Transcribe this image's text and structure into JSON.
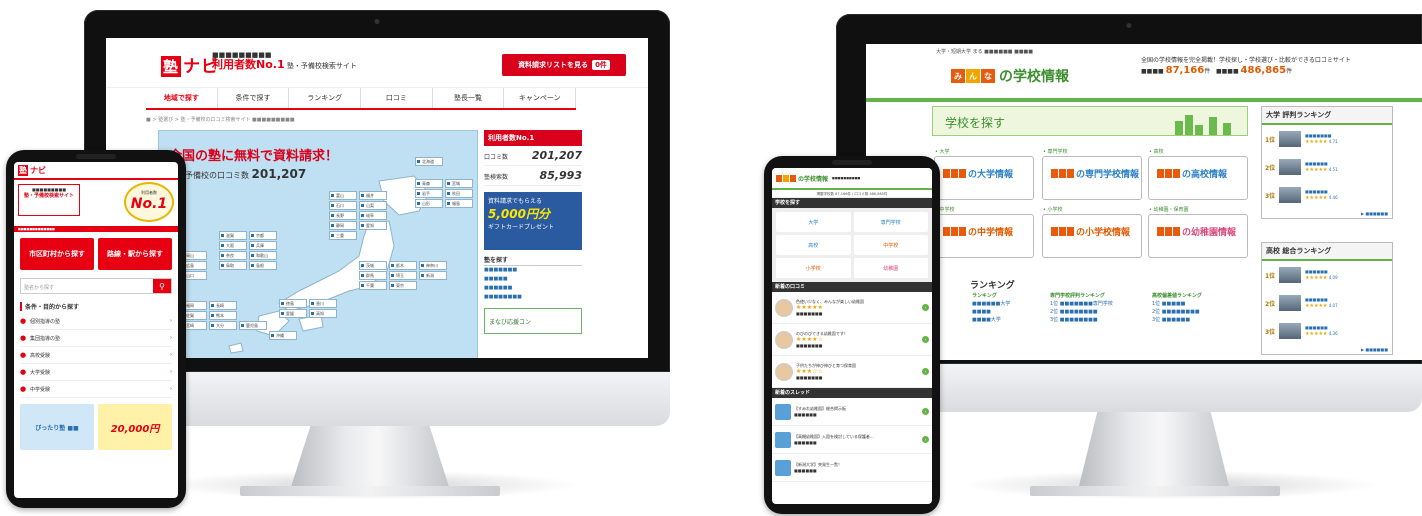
{
  "left_site": {
    "logo": "ナビ",
    "logo_kanji": "塾",
    "tagline_small": "■■■■■■■■■",
    "tagline_big": "利用者数No.1",
    "tagline_rest": "塾・予備校検索サイト",
    "cta": "資料請求リストを見る",
    "cta_count": "0件",
    "nav": [
      "地域で探す",
      "条件で探す",
      "ランキング",
      "口コミ",
      "塾長一覧",
      "キャンペーン"
    ],
    "breadcrumb": "■ > 塾選び > 塾・予備校の口コミ検索サイト ■■■■■■■■■",
    "hero_title": "全国の塾に無料で資料請求！",
    "hero_sub": "塾・予備校の口コミ数",
    "hero_count": "201,207",
    "prefectures": [
      "北海道",
      "青森",
      "岩手",
      "宮城",
      "秋田",
      "山形",
      "福島",
      "茨城",
      "栃木",
      "群馬",
      "埼玉",
      "千葉",
      "東京",
      "神奈川",
      "新潟",
      "富山",
      "石川",
      "福井",
      "山梨",
      "長野",
      "岐阜",
      "静岡",
      "愛知",
      "三重",
      "滋賀",
      "京都",
      "大阪",
      "兵庫",
      "奈良",
      "和歌山",
      "鳥取",
      "島根",
      "岡山",
      "広島",
      "山口",
      "徳島",
      "香川",
      "愛媛",
      "高知",
      "福岡",
      "佐賀",
      "長崎",
      "熊本",
      "大分",
      "宮崎",
      "鹿児島",
      "沖縄"
    ],
    "side_head": "利用者数No.1",
    "stats": [
      {
        "label": "口コミ数",
        "value": "201,207"
      },
      {
        "label": "塾検索数",
        "value": "85,993"
      }
    ],
    "promo_head": "資料請求でもらえる",
    "promo_value": "5,000円分",
    "promo_tail": "ギフトカードプレゼント",
    "links_title": "塾を探す",
    "links": [
      "■■■■■■■",
      "■■■■■",
      "■■■■■■",
      "■■■■■■■■"
    ],
    "green_banner": "まなび応援コン"
  },
  "right_site": {
    "topline": "大学・短期大学 まる ■■■■■■ ■■■■",
    "logo": "の学校情報",
    "tagline": "全国の学校情報を完全掲載！学校探し・学校選び・比較ができる口コミサイト",
    "stat1_label": "■■■■",
    "stat1_value": "87,166",
    "stat2_label": "■■■■",
    "stat2_value": "486,865",
    "search_title": "学校を探す",
    "cards": [
      {
        "cat": "• 大学",
        "name": "の大学情報",
        "color": "#2a7fc4"
      },
      {
        "cat": "• 専門学校",
        "name": "の専門学校情報",
        "color": "#2a7fc4"
      },
      {
        "cat": "• 高校",
        "name": "の高校情報",
        "color": "#2a7fc4"
      },
      {
        "cat": "• 中学校",
        "name": "の中学情報",
        "color": "#e05a00"
      },
      {
        "cat": "• 小学校",
        "name": "の小学校情報",
        "color": "#e05a00"
      },
      {
        "cat": "• 幼稚園・保育園",
        "name": "の幼稚園情報",
        "color": "#d9467a"
      }
    ],
    "rank_title": "ランキング",
    "rank_cols": [
      {
        "title": "ランキング",
        "rows": [
          "■■■■■■大学",
          "■■■■",
          "■■■■大学"
        ]
      },
      {
        "title": "専門学校評判ランキング",
        "rows": [
          "1位 ■■■■■■■専門学校",
          "2位 ■■■■■■■■",
          "3位 ■■■■■■■■"
        ]
      },
      {
        "title": "高校偏差値ランキング",
        "rows": [
          "1位 ■■■■■",
          "2位 ■■■■■■■■",
          "3位 ■■■■■■"
        ]
      }
    ],
    "side1_title": "大学 評判ランキング",
    "side1_rows": [
      {
        "rank": "1位",
        "name": "■■■■■■■",
        "score": "4.71"
      },
      {
        "rank": "2位",
        "name": "■■■■■■",
        "score": "4.51"
      },
      {
        "rank": "3位",
        "name": "■■■■■■",
        "score": "4.46"
      }
    ],
    "side2_title": "高校 総合ランキング",
    "side2_rows": [
      {
        "rank": "1位",
        "name": "■■■■■■",
        "score": "4.09"
      },
      {
        "rank": "2位",
        "name": "■■■■■■",
        "score": "4.07"
      },
      {
        "rank": "3位",
        "name": "■■■■■■",
        "score": "4.36"
      }
    ],
    "more": "▶ ■■■■■■"
  },
  "left_phone": {
    "logo": "ナビ",
    "logo_kanji": "塾",
    "banner_line1": "■■■■■■■■■",
    "banner_line2": "塾・予備校検索サイト",
    "medal_label": "利用者数",
    "medal_value": "No.1",
    "red_bar": "■■■■■■■■■■■■■",
    "btn1": "市区町村から探す",
    "btn2": "路線・駅から探す",
    "search_placeholder": "塾名から探す",
    "section": "条件・目的から探す",
    "items": [
      "個別指導の塾",
      "集団指導の塾",
      "高校受験",
      "大学受験",
      "中学受験"
    ],
    "ad1": "ぴったり塾 ■■",
    "ad2": "20,000円"
  },
  "right_phone": {
    "logo": "の学校情報",
    "sub": "■■■■■■■■■■",
    "stat": "掲載学校数 87,166件 / 口コミ数 486,865件",
    "sec1": "学校を探す",
    "cells": [
      "大学",
      "専門学校",
      "高校",
      "中学校",
      "小学校",
      "幼稚園"
    ],
    "sec2": "新着の口コミ",
    "reviews": [
      {
        "text": "色使い少なく、みんなが楽しい幼稚園",
        "sub": "■■■■■■■"
      },
      {
        "text": "のびのびできる幼稚園です！",
        "sub": "■■■■■■■"
      },
      {
        "text": "子供たちが伸び伸びと育つ保育園",
        "sub": "■■■■■■■"
      }
    ],
    "sec3": "新着のスレッド",
    "threads": [
      {
        "text": "【すみれ幼稚園】総合掲示板",
        "sub": "■■■■■■"
      },
      {
        "text": "【高槻幼稚園】入園を検討している保護者…",
        "sub": "■■■■■■"
      },
      {
        "text": "【新潟大学】突発生一覧！",
        "sub": "■■■■■■"
      }
    ]
  }
}
